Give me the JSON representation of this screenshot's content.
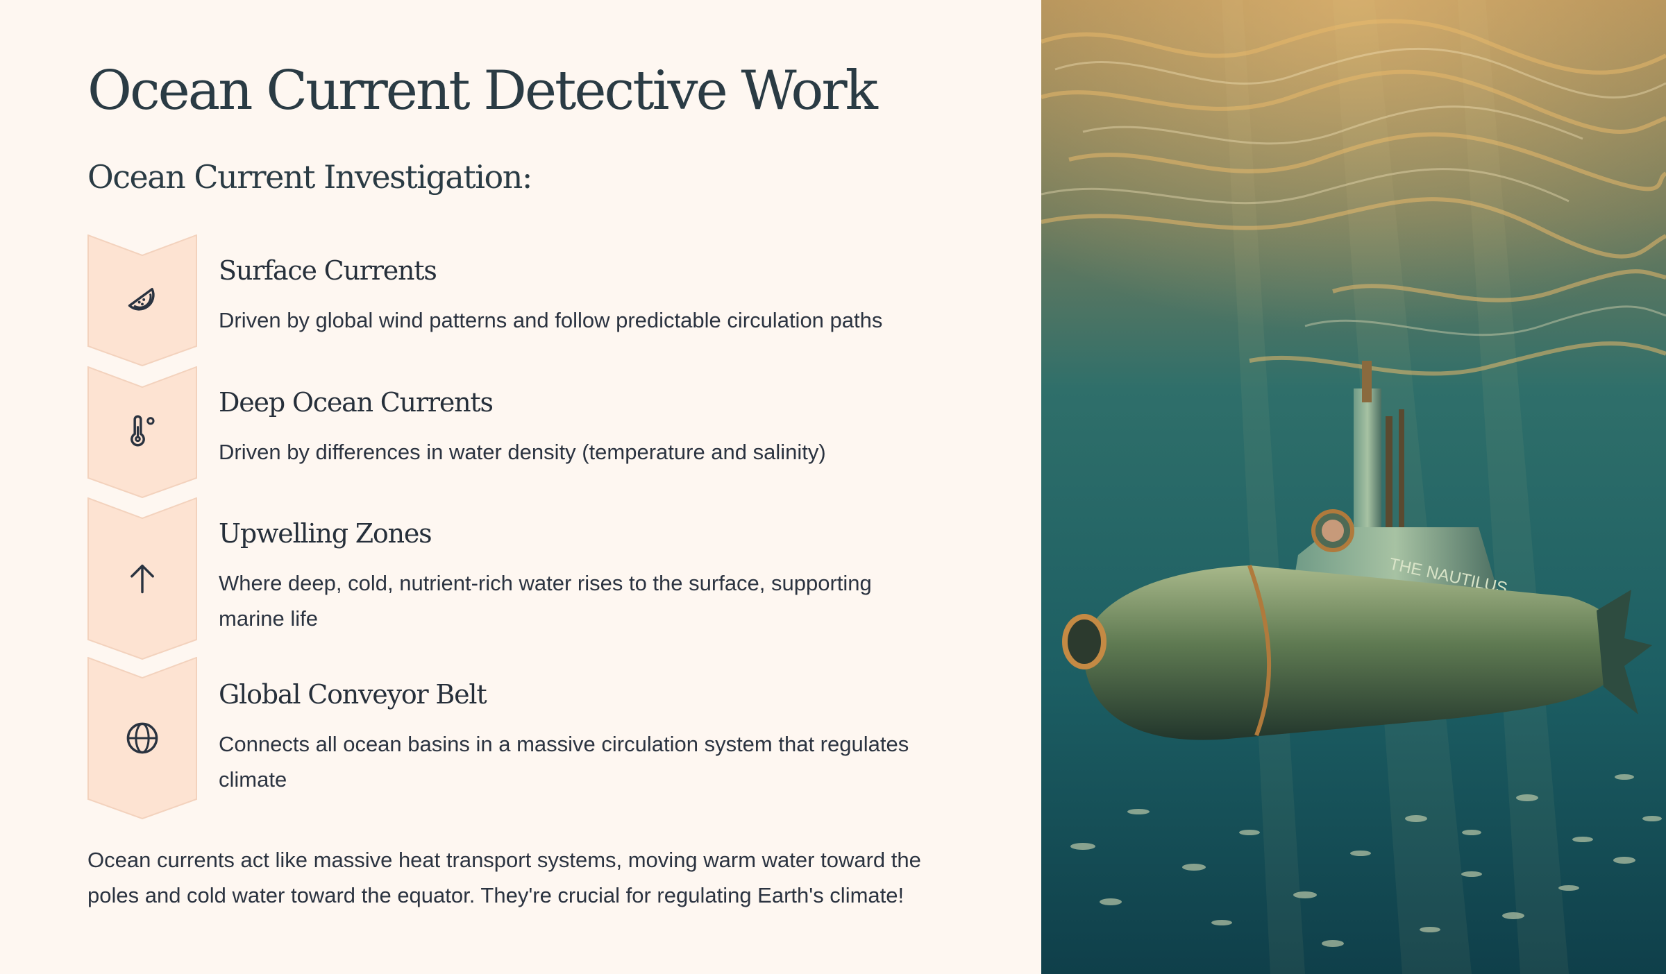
{
  "title": "Ocean Current Detective Work",
  "subtitle": "Ocean Current Investigation:",
  "items": [
    {
      "title": "Surface Currents",
      "description": "Driven by global wind patterns and follow predictable circulation paths",
      "icon": "watermelon-slice-icon"
    },
    {
      "title": "Deep Ocean Currents",
      "description": "Driven by differences in water density (temperature and salinity)",
      "icon": "thermometer-icon"
    },
    {
      "title": "Upwelling Zones",
      "description": "Where deep, cold, nutrient-rich water rises to the surface, supporting marine life",
      "icon": "arrow-up-icon"
    },
    {
      "title": "Global Conveyor Belt",
      "description": "Connects all ocean basins in a massive circulation system that regulates climate",
      "icon": "globe-icon"
    }
  ],
  "footer": "Ocean currents act like massive heat transport systems, moving warm water toward the poles and cold water toward the equator. They're crucial for regulating Earth's climate!",
  "image": {
    "hull_text": "THE NAUTILUS"
  },
  "colors": {
    "background": "#fef7f1",
    "chevron_fill": "#fde3d2",
    "chevron_stroke": "#f3d2bd",
    "heading": "#2a3b44",
    "text": "#2b3340"
  }
}
